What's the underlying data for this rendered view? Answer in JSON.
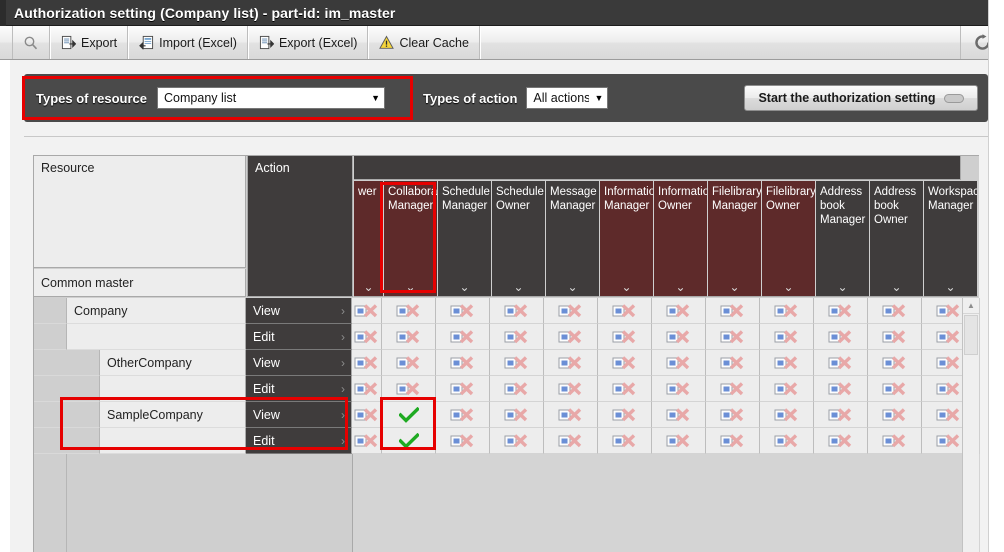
{
  "window": {
    "title": "Authorization setting (Company list) - part-id: im_master"
  },
  "toolbar": {
    "buttons": [
      {
        "label": "",
        "icon": "magnifier-icon"
      },
      {
        "label": "Export",
        "icon": "export-icon"
      },
      {
        "label": "Import (Excel)",
        "icon": "import-excel-icon"
      },
      {
        "label": "Export (Excel)",
        "icon": "export-excel-icon"
      },
      {
        "label": "Clear Cache",
        "icon": "warning-icon"
      }
    ],
    "refresh_icon": "refresh-icon"
  },
  "filterbar": {
    "resource_label": "Types of resource",
    "resource_value": "Company list",
    "action_label": "Types of action",
    "action_value": "All actions",
    "start_button_label": "Start the authorization setting",
    "caret": "▼"
  },
  "grid": {
    "resource_header": "Resource",
    "action_header": "Action",
    "group_header": "Common master",
    "chevron": "⌄",
    "columns": [
      {
        "label": "wer",
        "color": "red",
        "truncated": true
      },
      {
        "label": "Collaboration Manager",
        "color": "red",
        "highlighted": true
      },
      {
        "label": "Schedule Manager",
        "color": "gray"
      },
      {
        "label": "Schedule Owner",
        "color": "gray"
      },
      {
        "label": "Message Manager",
        "color": "gray"
      },
      {
        "label": "Information Manager",
        "color": "red"
      },
      {
        "label": "Information Owner",
        "color": "red"
      },
      {
        "label": "Filelibrary Manager",
        "color": "red"
      },
      {
        "label": "Filelibrary Owner",
        "color": "red"
      },
      {
        "label": "Address book Manager",
        "color": "gray"
      },
      {
        "label": "Address book Owner",
        "color": "gray"
      },
      {
        "label": "Workspace Manager",
        "color": "gray"
      }
    ],
    "rows": [
      {
        "resource": "Company",
        "indent": 0,
        "action": "View",
        "highlighted": false,
        "cells": [
          "deny",
          "deny",
          "deny",
          "deny",
          "deny",
          "deny",
          "deny",
          "deny",
          "deny",
          "deny",
          "deny",
          "deny"
        ]
      },
      {
        "resource": "",
        "indent": 0,
        "action": "Edit",
        "highlighted": false,
        "cells": [
          "deny",
          "deny",
          "deny",
          "deny",
          "deny",
          "deny",
          "deny",
          "deny",
          "deny",
          "deny",
          "deny",
          "deny"
        ]
      },
      {
        "resource": "OtherCompany",
        "indent": 1,
        "action": "View",
        "highlighted": false,
        "cells": [
          "deny",
          "deny",
          "deny",
          "deny",
          "deny",
          "deny",
          "deny",
          "deny",
          "deny",
          "deny",
          "deny",
          "deny"
        ]
      },
      {
        "resource": "",
        "indent": 1,
        "action": "Edit",
        "highlighted": false,
        "cells": [
          "deny",
          "deny",
          "deny",
          "deny",
          "deny",
          "deny",
          "deny",
          "deny",
          "deny",
          "deny",
          "deny",
          "deny"
        ]
      },
      {
        "resource": "SampleCompany",
        "indent": 1,
        "action": "View",
        "highlighted": true,
        "cells": [
          "deny",
          "allow",
          "deny",
          "deny",
          "deny",
          "deny",
          "deny",
          "deny",
          "deny",
          "deny",
          "deny",
          "deny"
        ]
      },
      {
        "resource": "",
        "indent": 1,
        "action": "Edit",
        "highlighted": true,
        "cells": [
          "deny",
          "allow",
          "deny",
          "deny",
          "deny",
          "deny",
          "deny",
          "deny",
          "deny",
          "deny",
          "deny",
          "deny"
        ]
      }
    ],
    "row_arrow": "›",
    "scrollbar_up": "▲"
  },
  "annotations": [
    {
      "name": "resource-filter-highlight"
    },
    {
      "name": "collaboration-manager-column-highlight"
    },
    {
      "name": "samplecompany-row-highlight"
    },
    {
      "name": "samplecompany-allow-cells-highlight"
    }
  ],
  "colors": {
    "titlebar_bg": "#3a3a3a",
    "filterbar_bg": "#4a4a4a",
    "header_red": "#5e2a2a",
    "header_gray": "#3f3c3c",
    "annotation_red": "#e60000",
    "allow_green": "#1faa22",
    "deny_pink": "#e8a8a8"
  }
}
